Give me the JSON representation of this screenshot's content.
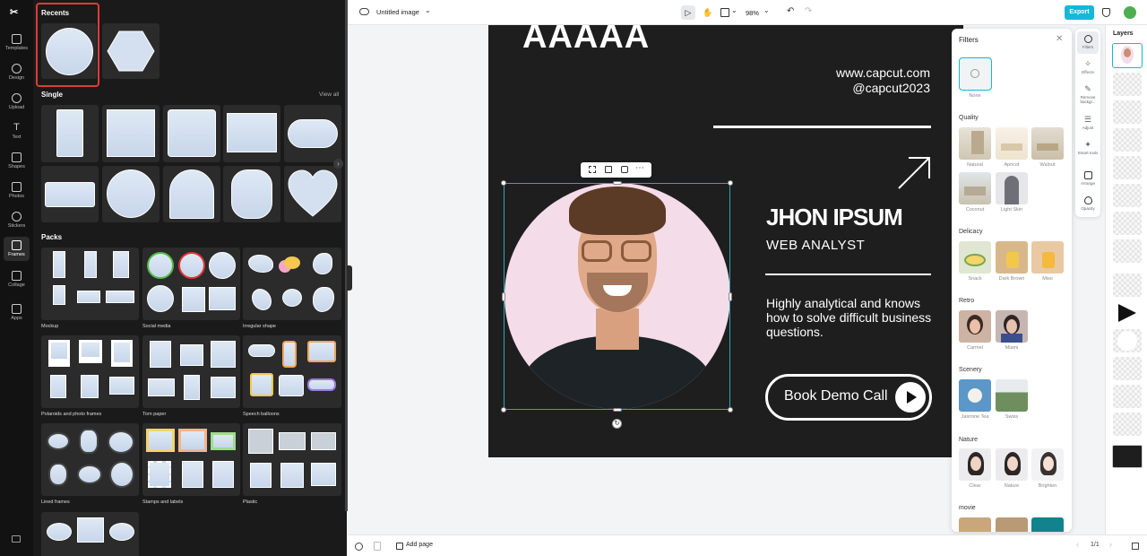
{
  "nav": {
    "items": [
      {
        "label": "Templates"
      },
      {
        "label": "Design"
      },
      {
        "label": "Upload"
      },
      {
        "label": "Text"
      },
      {
        "label": "Shapes"
      },
      {
        "label": "Photos"
      },
      {
        "label": "Stickers"
      },
      {
        "label": "Frames"
      },
      {
        "label": "Collage"
      },
      {
        "label": "Apps"
      }
    ]
  },
  "panel": {
    "recents_title": "Recents",
    "single_title": "Single",
    "view_all": "View all",
    "packs_title": "Packs",
    "packs": [
      {
        "label": "Mockup"
      },
      {
        "label": "Social media"
      },
      {
        "label": "Irregular shape"
      },
      {
        "label": "Polaroids and photo frames"
      },
      {
        "label": "Torn paper"
      },
      {
        "label": "Speech balloons"
      },
      {
        "label": "Lined frames"
      },
      {
        "label": "Stamps and labels"
      },
      {
        "label": "Plastic"
      }
    ]
  },
  "topbar": {
    "doc_title": "Untitled image",
    "zoom": "98%",
    "export_label": "Export"
  },
  "canvas": {
    "headline": "AAAAA",
    "website": "www.capcut.com",
    "handle": "@capcut2023",
    "name": "JHON IPSUM",
    "role": "WEB ANALYST",
    "description": "Highly analytical and knows how to solve difficult business questions.",
    "cta": "Book Demo Call"
  },
  "filters": {
    "title": "Filters",
    "none_label": "None",
    "sections": [
      {
        "title": "Quality",
        "items": [
          "Natural",
          "Apricot",
          "Walnut",
          "Coconut",
          "Light Skin"
        ]
      },
      {
        "title": "Delicacy",
        "items": [
          "Snack",
          "Dark Brown",
          "Miso"
        ]
      },
      {
        "title": "Retro",
        "items": [
          "Carmel",
          "Miami"
        ]
      },
      {
        "title": "Scenery",
        "items": [
          "Jasmine Tea",
          "Swiss"
        ]
      },
      {
        "title": "Nature",
        "items": [
          "Clear",
          "Nature",
          "Brighten"
        ]
      },
      {
        "title": "movie",
        "items": []
      }
    ]
  },
  "tools": {
    "items": [
      "Filters",
      "Effects",
      "Remove backgr...",
      "Adjust",
      "Smart tools",
      "Arrange",
      "Opacity"
    ]
  },
  "layers": {
    "title": "Layers"
  },
  "bottombar": {
    "add_page": "Add page",
    "page_indicator": "1/1"
  },
  "colors": {
    "accent": "#14b8d8",
    "canvas_bg": "#1e1e1e",
    "panel_bg": "#1a1a1a",
    "selection": "#2aa7b8",
    "recent_outline": "#e03a3a"
  }
}
